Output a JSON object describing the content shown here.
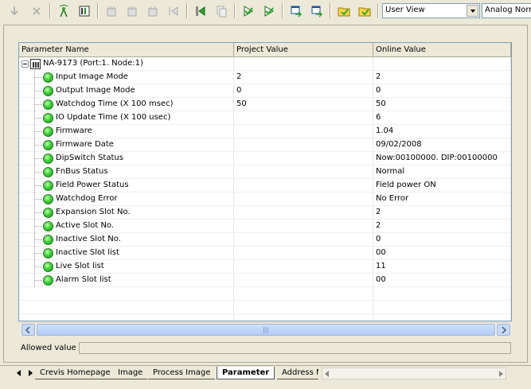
{
  "toolbar": {
    "view_combo": "User View",
    "mode_combo": "Analog Normal",
    "icons": [
      "arrow-down-icon",
      "close-icon",
      "antenna-icon",
      "module-icon",
      "grid-icon",
      "upload-icon",
      "download-icon",
      "jump-icon",
      "export-icon",
      "copy-icon",
      "check-down-icon",
      "check-icon",
      "window-icon",
      "window-arrow-icon",
      "folder-icon",
      "folder-check-icon"
    ]
  },
  "grid": {
    "columns": [
      "Parameter Name",
      "Project Value",
      "Online Value"
    ],
    "root": "NA-9173 (Port:1. Node:1)",
    "rows": [
      {
        "name": "Input Image Mode",
        "project": "2",
        "online": "2"
      },
      {
        "name": "Output Image Mode",
        "project": "0",
        "online": "0"
      },
      {
        "name": "Watchdog Time (X 100 msec)",
        "project": "50",
        "online": "50"
      },
      {
        "name": "IO Update Time (X 100 usec)",
        "project": "",
        "online": "6"
      },
      {
        "name": "Firmware",
        "project": "",
        "online": "1.04"
      },
      {
        "name": "Firmware Date",
        "project": "",
        "online": "09/02/2008"
      },
      {
        "name": "DipSwitch Status",
        "project": "",
        "online": "Now:00100000. DIP:00100000"
      },
      {
        "name": "FnBus Status",
        "project": "",
        "online": "Normal"
      },
      {
        "name": "Field Power Status",
        "project": "",
        "online": "Field power ON"
      },
      {
        "name": "Watchdog Error",
        "project": "",
        "online": "No Error"
      },
      {
        "name": "Expansion Slot No.",
        "project": "",
        "online": "2"
      },
      {
        "name": "Active Slot No.",
        "project": "",
        "online": "2"
      },
      {
        "name": "Inactive Slot No.",
        "project": "",
        "online": "0"
      },
      {
        "name": "Inactive Slot list",
        "project": "",
        "online": "00"
      },
      {
        "name": "Live Slot list",
        "project": "",
        "online": "11"
      },
      {
        "name": "Alarm Slot list",
        "project": "",
        "online": "00"
      }
    ]
  },
  "scrollbar": {
    "grip": "|||"
  },
  "allowed": {
    "label": "Allowed value",
    "value": ""
  },
  "tabs": {
    "items": [
      "Crevis Homepage",
      "Image",
      "Process Image",
      "Parameter",
      "Address Map"
    ],
    "active": "Parameter"
  },
  "colors": {
    "led": "#3fd13a",
    "scroll": "#b3cbf5",
    "background": "#ece9d8"
  }
}
